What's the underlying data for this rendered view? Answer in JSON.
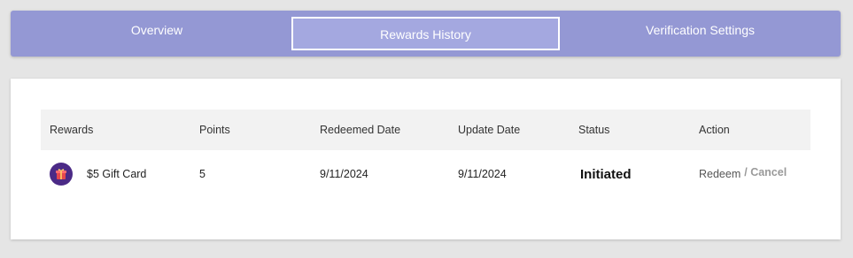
{
  "tabs": [
    {
      "label": "Overview",
      "active": false
    },
    {
      "label": "Rewards History",
      "active": true
    },
    {
      "label": "Verification Settings",
      "active": false
    }
  ],
  "table": {
    "headers": [
      "Rewards",
      "Points",
      "Redeemed Date",
      "Update Date",
      "Status",
      "Action"
    ],
    "rows": [
      {
        "reward_icon": "gift-card-icon",
        "reward": "$5 Gift Card",
        "points": "5",
        "redeemed_date": "9/11/2024",
        "update_date": "9/11/2024",
        "status": "Initiated",
        "action_redeem": "Redeem",
        "action_cancel": "/ Cancel"
      }
    ]
  },
  "colors": {
    "tabbar": "#9498d4",
    "active_tab": "#a4a8e0",
    "header_row": "#f2f2f2",
    "reward_icon_bg": "#4b2a86",
    "gift_red": "#e5484d"
  }
}
